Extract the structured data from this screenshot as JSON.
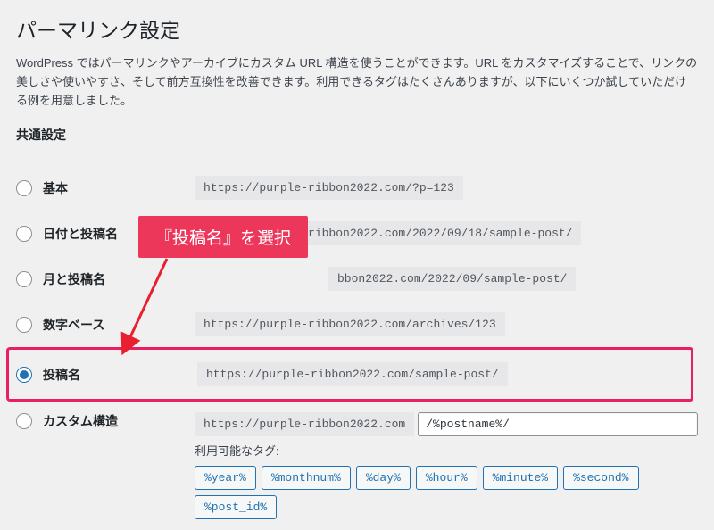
{
  "page": {
    "title": "パーマリンク設定",
    "description": "WordPress ではパーマリンクやアーカイブにカスタム URL 構造を使うことができます。URL をカスタマイズすることで、リンクの美しさや使いやすさ、そして前方互換性を改善できます。利用できるタグはたくさんありますが、以下にいくつか試していただける例を用意しました。",
    "section_title": "共通設定"
  },
  "options": {
    "basic": {
      "label": "基本",
      "url": "https://purple-ribbon2022.com/?p=123"
    },
    "date_name": {
      "label": "日付と投稿名",
      "url": "https://purple-ribbon2022.com/2022/09/18/sample-post/"
    },
    "month_name": {
      "label": "月と投稿名",
      "url": "bbon2022.com/2022/09/sample-post/"
    },
    "numeric": {
      "label": "数字ベース",
      "url": "https://purple-ribbon2022.com/archives/123"
    },
    "post_name": {
      "label": "投稿名",
      "url": "https://purple-ribbon2022.com/sample-post/"
    },
    "custom": {
      "label": "カスタム構造",
      "prefix": "https://purple-ribbon2022.com",
      "value": "/%postname%/"
    }
  },
  "tags": {
    "label": "利用可能なタグ:",
    "items": [
      "%year%",
      "%monthnum%",
      "%day%",
      "%hour%",
      "%minute%",
      "%second%",
      "%post_id%"
    ]
  },
  "annotation": {
    "callout": "『投稿名』を選択"
  }
}
